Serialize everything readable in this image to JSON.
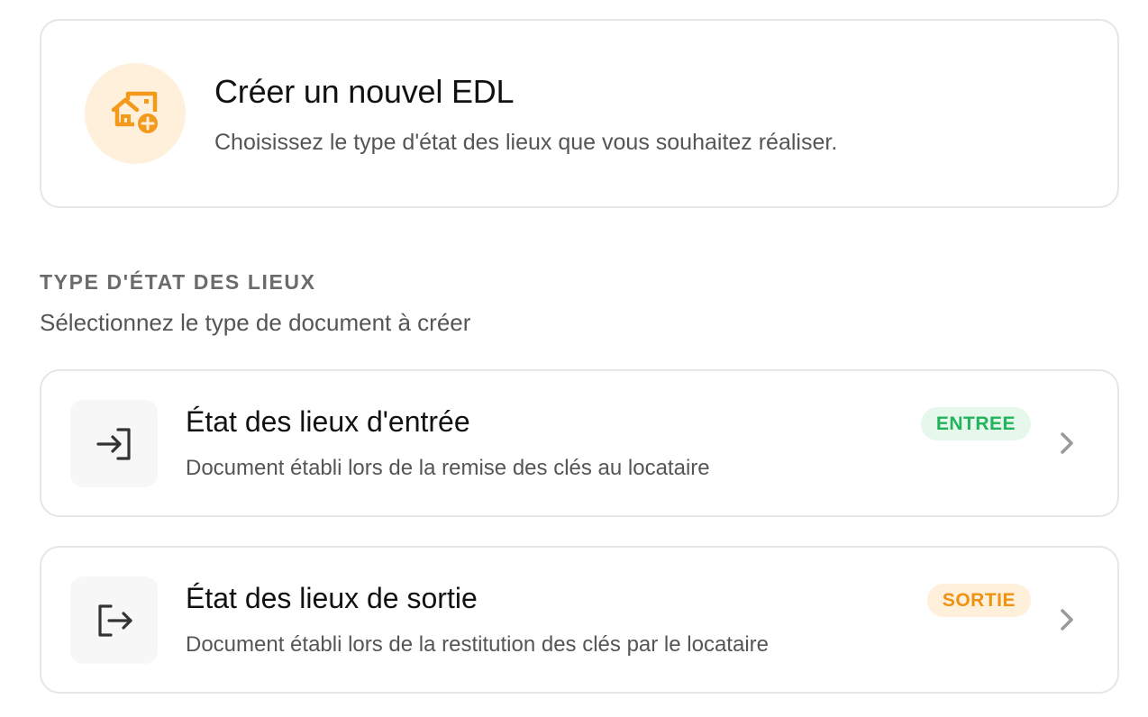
{
  "header": {
    "title": "Créer un nouvel EDL",
    "subtitle": "Choisissez le type d'état des lieux que vous souhaitez réaliser.",
    "icon": "house-plus-icon",
    "accent_color": "#f39a1c",
    "icon_bg_color": "#fff0dc"
  },
  "section": {
    "label": "TYPE D'ÉTAT DES LIEUX",
    "description": "Sélectionnez le type de document à créer"
  },
  "options": [
    {
      "title": "État des lieux d'entrée",
      "description": "Document établi lors de la remise des clés au locataire",
      "badge": "ENTREE",
      "badge_color": "#22b45a",
      "icon": "login-icon"
    },
    {
      "title": "État des lieux de sortie",
      "description": "Document établi lors de la restitution des clés par le locataire",
      "badge": "SORTIE",
      "badge_color": "#ef9210",
      "icon": "logout-icon"
    }
  ]
}
